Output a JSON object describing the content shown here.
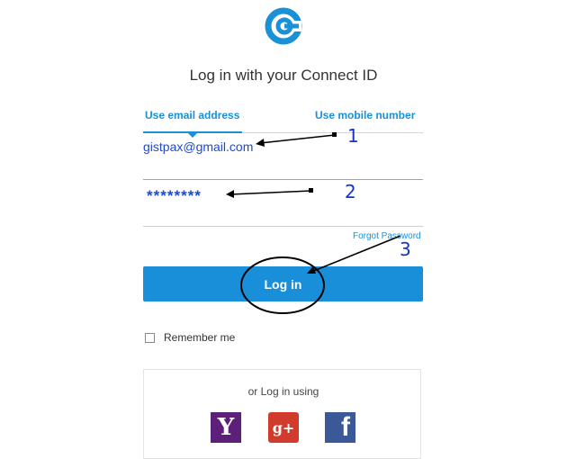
{
  "title": "Log in with your Connect ID",
  "tabs": [
    {
      "label": "Use email address",
      "selected": true
    },
    {
      "label": "Use mobile number",
      "selected": false
    }
  ],
  "email": {
    "value": "gistpax@gmail.com"
  },
  "password": {
    "value": "********"
  },
  "forgot_password": "Forgot Password",
  "login_button": "Log in",
  "remember_me": {
    "label": "Remember me",
    "checked": false
  },
  "social": {
    "title": "or Log in using",
    "providers": [
      {
        "name": "Yahoo",
        "glyph": "Y",
        "color": "#5c1f7a"
      },
      {
        "name": "Google Plus",
        "glyph": "g+",
        "color": "#d13b2d"
      },
      {
        "name": "Facebook",
        "glyph": "f",
        "color": "#3b5998"
      }
    ]
  },
  "annotations": {
    "n1": "1",
    "n2": "2",
    "n3": "3"
  },
  "colors": {
    "accent": "#1a90d6",
    "annotation": "#1533c9"
  }
}
